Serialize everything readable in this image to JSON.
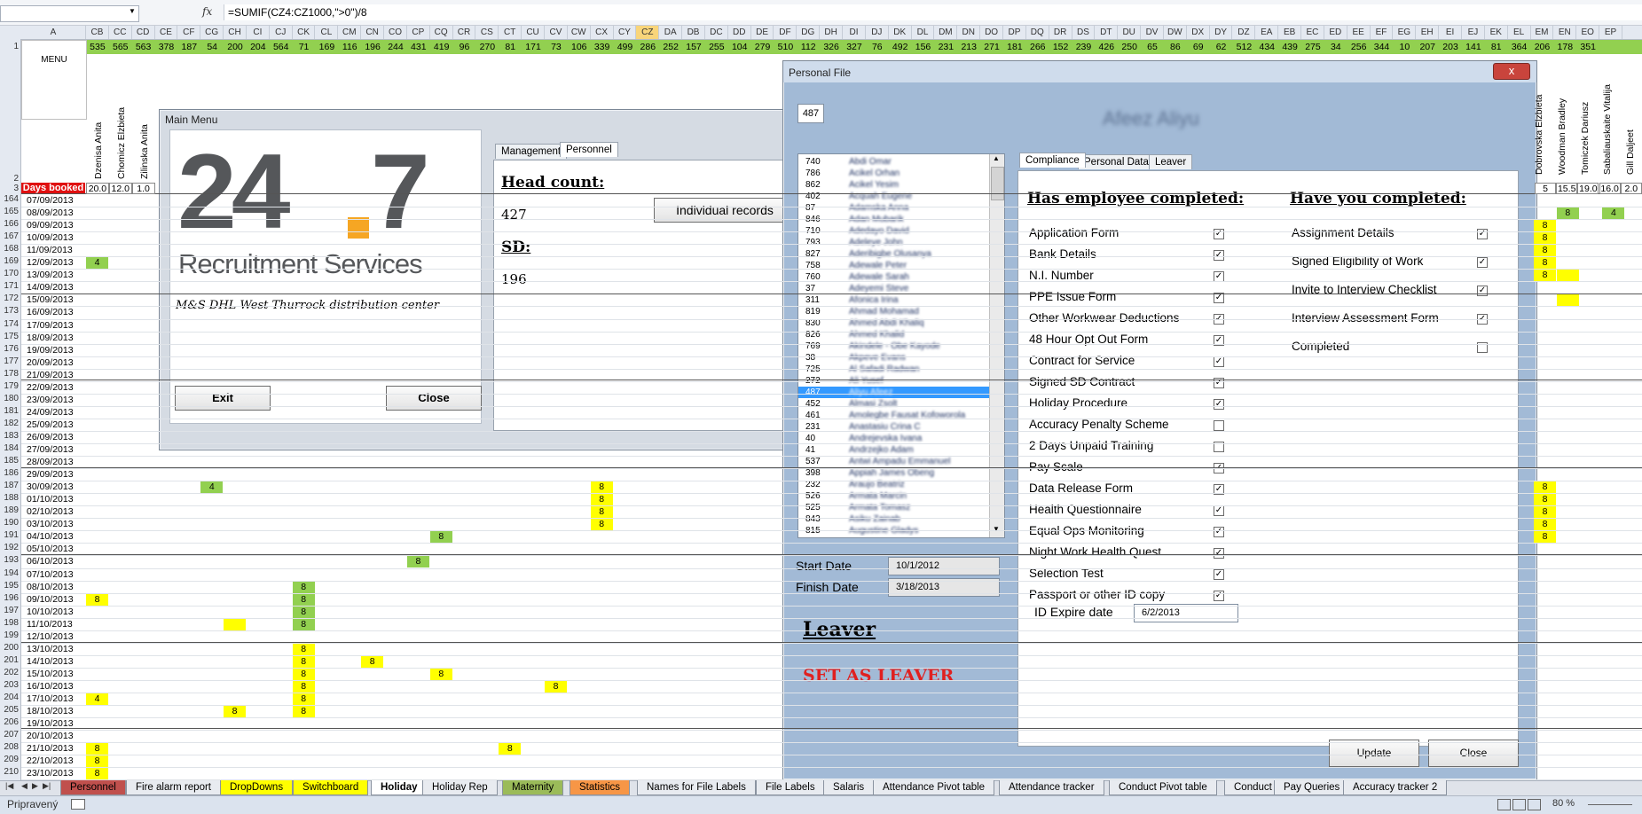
{
  "formula_bar": {
    "name_box": "",
    "fx": "fx",
    "formula": "=SUMIF(CZ4:CZ1000,\">0\")/8"
  },
  "columns": [
    "A",
    "CB",
    "CC",
    "CD",
    "CE",
    "CF",
    "CG",
    "CH",
    "CI",
    "CJ",
    "CK",
    "CL",
    "CM",
    "CN",
    "CO",
    "CP",
    "CQ",
    "CR",
    "CS",
    "CT",
    "CU",
    "CV",
    "CW",
    "CX",
    "CY",
    "CZ",
    "DA",
    "DB",
    "DC",
    "DD",
    "DE",
    "DF",
    "DG",
    "DH",
    "DI",
    "DJ",
    "DK",
    "DL",
    "DM",
    "DN",
    "DO",
    "DP",
    "DQ",
    "DR",
    "DS",
    "DT",
    "DU",
    "DV",
    "DW",
    "DX",
    "DY",
    "DZ",
    "EA",
    "EB",
    "EC",
    "ED",
    "EE",
    "EF",
    "EG",
    "EH",
    "EI",
    "EJ",
    "EK",
    "EL",
    "EM",
    "EN",
    "EO",
    "EP"
  ],
  "row1_values": [
    "535",
    "565",
    "563",
    "378",
    "187",
    "54",
    "200",
    "204",
    "564",
    "71",
    "169",
    "116",
    "196",
    "244",
    "431",
    "419",
    "96",
    "270",
    "81",
    "171",
    "73",
    "106",
    "339",
    "499",
    "286",
    "252",
    "157",
    "255",
    "104",
    "279",
    "510",
    "112",
    "326",
    "327",
    "76",
    "492",
    "156",
    "231",
    "213",
    "271",
    "181",
    "266",
    "152",
    "239",
    "426",
    "250",
    "65",
    "86",
    "69",
    "62",
    "512",
    "434",
    "439",
    "275",
    "34",
    "256",
    "344",
    "10",
    "207",
    "203",
    "141",
    "81",
    "364",
    "206",
    "178",
    "351"
  ],
  "menu_label": "MENU",
  "row3": {
    "label": "Days booked",
    "values": [
      "20.0",
      "12.0",
      "1.0"
    ],
    "right_values": [
      "5",
      "15.5",
      "19.0",
      "16.0",
      "2.0"
    ]
  },
  "employee_names": [
    "Dzenisa Anita",
    "Chomicz Elzbieta",
    "Zilinska Anita"
  ],
  "right_names": [
    "Dobrovska Elzbieta",
    "Woodman Bradley",
    "Tomiczek Dariusz",
    "Sabaliauskaite Vitalija",
    "Gill Daljeet"
  ],
  "row_numbers": [
    "1",
    "2",
    "3",
    "164",
    "165",
    "166",
    "167",
    "168",
    "169",
    "170",
    "171",
    "172",
    "173",
    "174",
    "175",
    "176",
    "177",
    "178",
    "179",
    "180",
    "181",
    "182",
    "183",
    "184",
    "185",
    "186",
    "187",
    "188",
    "189",
    "190",
    "191",
    "192",
    "193",
    "194",
    "195",
    "196",
    "197",
    "198",
    "199",
    "200",
    "201",
    "202",
    "203",
    "204",
    "205",
    "206",
    "207",
    "208",
    "209",
    "210"
  ],
  "dates": [
    "07/09/2013",
    "08/09/2013",
    "09/09/2013",
    "10/09/2013",
    "11/09/2013",
    "12/09/2013",
    "13/09/2013",
    "14/09/2013",
    "15/09/2013",
    "16/09/2013",
    "17/09/2013",
    "18/09/2013",
    "19/09/2013",
    "20/09/2013",
    "21/09/2013",
    "22/09/2013",
    "23/09/2013",
    "24/09/2013",
    "25/09/2013",
    "26/09/2013",
    "27/09/2013",
    "28/09/2013",
    "29/09/2013",
    "30/09/2013",
    "01/10/2013",
    "02/10/2013",
    "03/10/2013",
    "04/10/2013",
    "05/10/2013",
    "06/10/2013",
    "07/10/2013",
    "08/10/2013",
    "09/10/2013",
    "10/10/2013",
    "11/10/2013",
    "12/10/2013",
    "13/10/2013",
    "14/10/2013",
    "15/10/2013",
    "16/10/2013",
    "17/10/2013",
    "18/10/2013",
    "19/10/2013",
    "20/10/2013",
    "21/10/2013",
    "22/10/2013",
    "23/10/2013"
  ],
  "cell_values": {
    "four": "4",
    "eight": "8"
  },
  "sheet_tabs": [
    "Personnel",
    "Fire alarm report",
    "DropDowns",
    "Switchboard",
    "Holiday",
    "Holiday Rep",
    "Maternity",
    "Statistics",
    "Names for File Labels",
    "File Labels",
    "Salaris",
    "Attendance Pivot table",
    "Attendance tracker",
    "Conduct Pivot table",
    "Conduct",
    "Pay Queries",
    "Accuracy tracker 2"
  ],
  "status": {
    "ready": "Pripravený",
    "zoom": "80 %"
  },
  "main_menu": {
    "title": "Main Menu",
    "logo_text_big": "24",
    "logo_text_big2": "7",
    "logo_text_small": "Recruitment Services",
    "site": "M&S DHL West Thurrock distribution center",
    "exit": "Exit",
    "close": "Close",
    "tabs": [
      "Management",
      "Personnel"
    ],
    "head_count_label": "Head count:",
    "head_count": "427",
    "sd_label": "SD:",
    "sd": "196",
    "individual_records": "Individual records"
  },
  "personal_file": {
    "title": "Personal File",
    "id": "487",
    "name": "Afeez Aliyu",
    "list": [
      {
        "id": "740",
        "name": "Abdi Omar"
      },
      {
        "id": "786",
        "name": "Acikel Orhan"
      },
      {
        "id": "862",
        "name": "Acikel Yesim"
      },
      {
        "id": "402",
        "name": "Acquah Eugene"
      },
      {
        "id": "87",
        "name": "Adamska Anna"
      },
      {
        "id": "846",
        "name": "Adan Mubarik"
      },
      {
        "id": "710",
        "name": "Adedayo David"
      },
      {
        "id": "793",
        "name": "Adeleye John"
      },
      {
        "id": "827",
        "name": "Aderibigbe Olusanya"
      },
      {
        "id": "758",
        "name": "Adewale Peter"
      },
      {
        "id": "760",
        "name": "Adewale Sarah"
      },
      {
        "id": "37",
        "name": "Adeyemi Steve"
      },
      {
        "id": "311",
        "name": "Afonica Irina"
      },
      {
        "id": "819",
        "name": "Ahmad Mohamad"
      },
      {
        "id": "830",
        "name": "Ahmed Abdi Khaliq"
      },
      {
        "id": "826",
        "name": "Ahmed Khalid"
      },
      {
        "id": "769",
        "name": "Akindele - Obe Kayode"
      },
      {
        "id": "38",
        "name": "Akpeve Evans"
      },
      {
        "id": "725",
        "name": "Al Safadi Radwan"
      },
      {
        "id": "272",
        "name": "Ali Yusef"
      },
      {
        "id": "487",
        "name": "Aliyu Afeez"
      },
      {
        "id": "452",
        "name": "Almasi Zsolt"
      },
      {
        "id": "461",
        "name": "Amolegbe Fausat Kofoworola"
      },
      {
        "id": "231",
        "name": "Anastasiu Crina C"
      },
      {
        "id": "40",
        "name": "Andrejevska Ivana"
      },
      {
        "id": "41",
        "name": "Andrzejko Adam"
      },
      {
        "id": "537",
        "name": "Antwi Ampadu Emmanuel"
      },
      {
        "id": "398",
        "name": "Appiah James Obeng"
      },
      {
        "id": "232",
        "name": "Araujo Beatriz"
      },
      {
        "id": "526",
        "name": "Armata Marcin"
      },
      {
        "id": "525",
        "name": "Armata Tomasz"
      },
      {
        "id": "843",
        "name": "Asiku Zainab"
      },
      {
        "id": "815",
        "name": "Augustine Gladys"
      }
    ],
    "start_date_label": "Start Date",
    "start_date": "10/1/2012",
    "finish_date_label": "Finish Date",
    "finish_date": "3/18/2013",
    "leaver_label": "Leaver",
    "set_as_leaver": "SET AS LEAVER",
    "tabs": [
      "Compliance",
      "Personal Data",
      "Leaver"
    ],
    "employee_heading": "Has employee completed:",
    "you_heading": "Have you completed:",
    "employee_items": [
      {
        "label": "Application Form",
        "checked": true
      },
      {
        "label": "Bank Details",
        "checked": true
      },
      {
        "label": "N.I. Number",
        "checked": true
      },
      {
        "label": "PPE Issue Form",
        "checked": true
      },
      {
        "label": "Other Workwear Deductions",
        "checked": true
      },
      {
        "label": "48 Hour Opt Out Form",
        "checked": true
      },
      {
        "label": "Contract for Service",
        "checked": true
      },
      {
        "label": "Signed SD Contract",
        "checked": true
      },
      {
        "label": "Holiday Procedure",
        "checked": true
      },
      {
        "label": "Accuracy Penalty Scheme",
        "checked": false
      },
      {
        "label": "2 Days Unpaid Training",
        "checked": false
      },
      {
        "label": "Pay Scale",
        "checked": true
      },
      {
        "label": "Data Release Form",
        "checked": true
      },
      {
        "label": "Health Questionnaire",
        "checked": true
      },
      {
        "label": "Equal Ops Monitoring",
        "checked": true
      },
      {
        "label": "Night Work Health Quest.",
        "checked": true
      },
      {
        "label": "Selection Test",
        "checked": true
      },
      {
        "label": "Passport or other ID copy",
        "checked": true
      }
    ],
    "you_items": [
      {
        "label": "Assignment Details",
        "checked": true
      },
      {
        "label": "Signed Eligibility of Work",
        "checked": true
      },
      {
        "label": "Invite to Interview Checklist",
        "checked": true
      },
      {
        "label": "Interview Assessment Form",
        "checked": true
      },
      {
        "label": "Completed",
        "checked": false
      }
    ],
    "id_expire_label": "ID Expire date",
    "id_expire": "6/2/2013",
    "update": "Update",
    "close": "Close",
    "x": "x"
  },
  "colors": {
    "green": "#92d050",
    "yellow": "#ffff00",
    "red": "#e01010",
    "selected": "#3399ff"
  }
}
